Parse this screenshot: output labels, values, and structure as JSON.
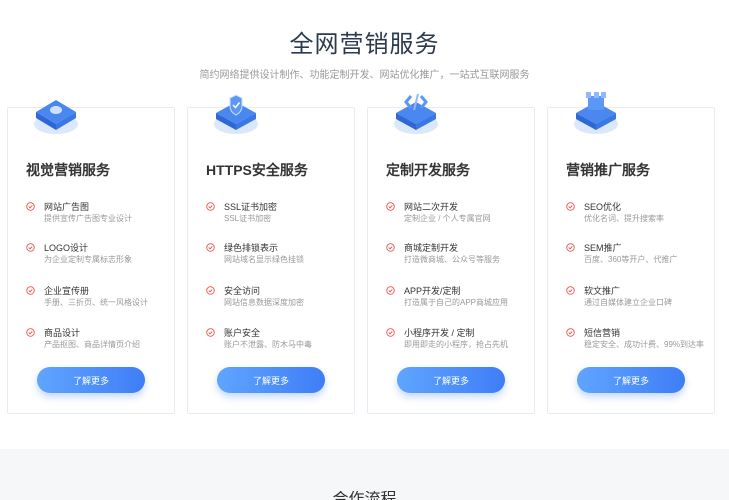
{
  "header": {
    "title": "全网营销服务",
    "subtitle": "简约网络提供设计制作、功能定制开发、网站优化推广，一站式互联网服务"
  },
  "cards": [
    {
      "title": "视觉营销服务",
      "icon": "monitor-icon",
      "features": [
        {
          "title": "网站广告图",
          "desc": "提供宣传广告图专业设计"
        },
        {
          "title": "LOGO设计",
          "desc": "为企业定制专属标志形象"
        },
        {
          "title": "企业宣传册",
          "desc": "手册、三折页、统一风格设计"
        },
        {
          "title": "商品设计",
          "desc": "产品抠图、商品详情页介绍"
        }
      ],
      "button": "了解更多"
    },
    {
      "title": "HTTPS安全服务",
      "icon": "shield-icon",
      "features": [
        {
          "title": "SSL证书加密",
          "desc": "SSL证书加密"
        },
        {
          "title": "绿色排锁表示",
          "desc": "网站域名显示绿色挂锁"
        },
        {
          "title": "安全访问",
          "desc": "网站信息数据深度加密"
        },
        {
          "title": "账户安全",
          "desc": "账户不泄露、防木马中毒"
        }
      ],
      "button": "了解更多"
    },
    {
      "title": "定制开发服务",
      "icon": "code-icon",
      "features": [
        {
          "title": "网站二次开发",
          "desc": "定制企业 / 个人专属官网"
        },
        {
          "title": "商城定制开发",
          "desc": "打造微商城、公众号等服务"
        },
        {
          "title": "APP开发/定制",
          "desc": "打造属于自己的APP商城应用"
        },
        {
          "title": "小程序开发 / 定制",
          "desc": "即用即走的小程序，抢占先机"
        }
      ],
      "button": "了解更多"
    },
    {
      "title": "营销推广服务",
      "icon": "megaphone-icon",
      "features": [
        {
          "title": "SEO优化",
          "desc": "优化名词、提升搜索率"
        },
        {
          "title": "SEM推广",
          "desc": "百度、360等开户、代推广"
        },
        {
          "title": "软文推广",
          "desc": "通过自媒体建立企业口碑"
        },
        {
          "title": "短信营销",
          "desc": "稳定安全、成功计费、99%到达率"
        }
      ],
      "button": "了解更多"
    }
  ],
  "bottom": {
    "peek_title": "合作流程"
  },
  "colors": {
    "accent": "#3f7df6",
    "check": "#e8554e",
    "title": "#2c3a4f"
  }
}
